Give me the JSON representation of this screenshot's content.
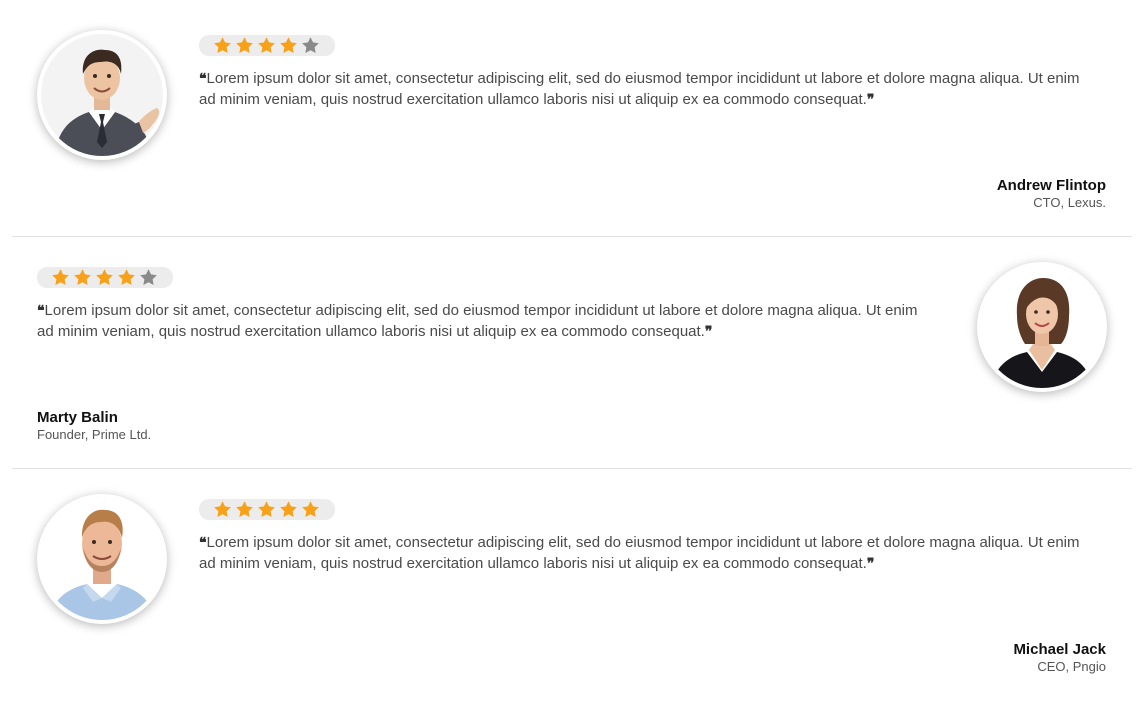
{
  "colors": {
    "star_filled": "#f7a11a",
    "star_empty": "#8a8a8a",
    "rating_pill": "#ececec",
    "divider": "#e2e2e2"
  },
  "testimonials": [
    {
      "rating": 4,
      "max_rating": 5,
      "quote_open": "❝",
      "quote": "Lorem ipsum dolor sit amet, consectetur adipiscing elit, sed do eiusmod tempor incididunt ut labore et dolore magna aliqua. Ut enim ad minim veniam, quis nostrud exercitation ullamco laboris nisi ut aliquip ex ea commodo consequat.",
      "quote_close": "❞",
      "name": "Andrew Flintop",
      "role": "CTO, Lexus.",
      "avatar": "man-in-suit-photo",
      "avatar_side": "left"
    },
    {
      "rating": 4,
      "max_rating": 5,
      "quote_open": "❝",
      "quote": "Lorem ipsum dolor sit amet, consectetur adipiscing elit, sed do eiusmod tempor incididunt ut labore et dolore magna aliqua. Ut enim ad minim veniam, quis nostrud exercitation ullamco laboris nisi ut aliquip ex ea commodo consequat.",
      "quote_close": "❞",
      "name": "Marty Balin",
      "role": "Founder, Prime Ltd.",
      "avatar": "woman-in-blazer-photo",
      "avatar_side": "right"
    },
    {
      "rating": 5,
      "max_rating": 5,
      "quote_open": "❝",
      "quote": "Lorem ipsum dolor sit amet, consectetur adipiscing elit, sed do eiusmod tempor incididunt ut labore et dolore magna aliqua. Ut enim ad minim veniam, quis nostrud exercitation ullamco laboris nisi ut aliquip ex ea commodo consequat.",
      "quote_close": "❞",
      "name": "Michael Jack",
      "role": "CEO, Pngio",
      "avatar": "man-in-shirt-photo",
      "avatar_side": "left"
    }
  ]
}
